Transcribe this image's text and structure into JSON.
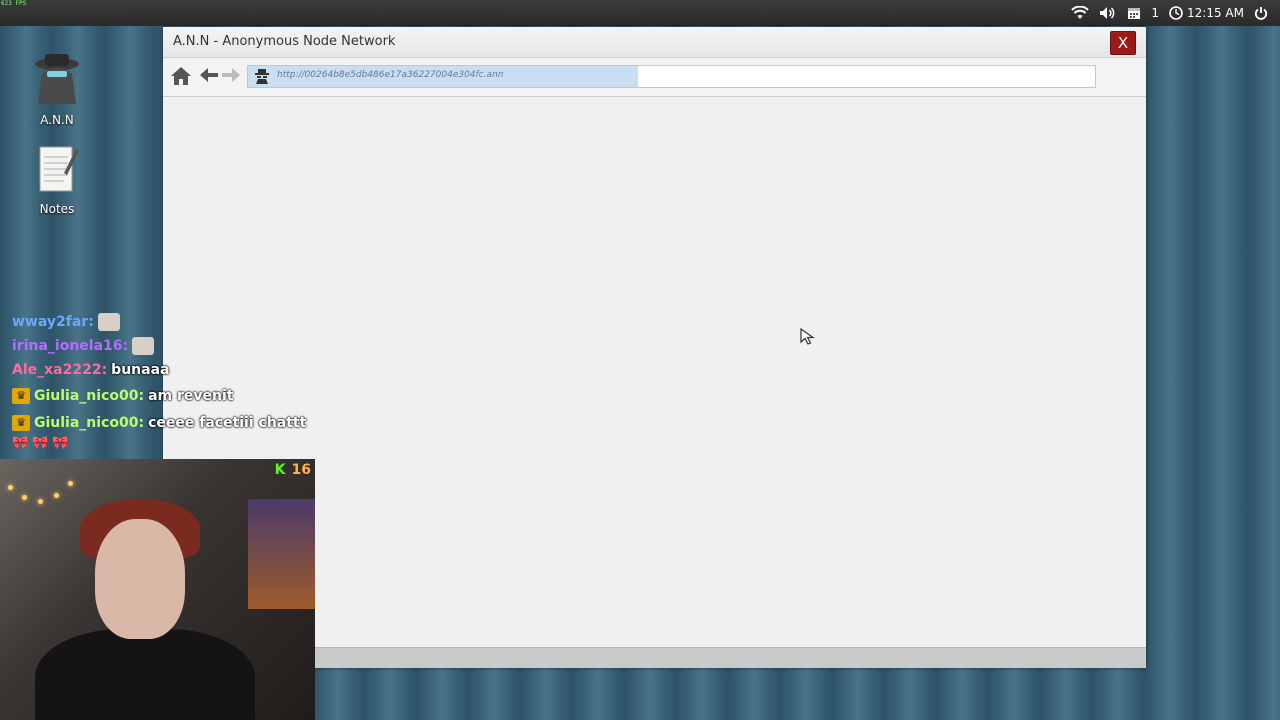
{
  "overlay": {
    "fps_text": "623 FPS"
  },
  "system_tray": {
    "notifications_count": "1",
    "time": "12:15 AM"
  },
  "desktop": {
    "icons": [
      {
        "label": "A.N.N",
        "icon": "hacker-hat-icon"
      },
      {
        "label": "Notes",
        "icon": "notepad-icon"
      }
    ]
  },
  "window": {
    "title": "A.N.N - Anonymous Node Network",
    "close_label": "X",
    "address_bar": {
      "url": "http://00264b8e5db486e17a36227004e304fc.ann",
      "load_progress": 0.46
    }
  },
  "chat": [
    {
      "user": "wway2far:",
      "user_color": "#6aa8ff",
      "badge": null,
      "message": "",
      "emote": true
    },
    {
      "user": "irina_ionela16:",
      "user_color": "#b46cff",
      "badge": null,
      "message": "",
      "emote": true
    },
    {
      "user": "Ale_xa2222:",
      "user_color": "#ff6aa0",
      "badge": null,
      "message": "bunaaa",
      "emote": false
    },
    {
      "user": "Giulia_nico00:",
      "user_color": "#b8ff6a",
      "badge": "crown-icon",
      "message": "am revenit",
      "emote": false
    },
    {
      "user": "Giulia_nico00:",
      "user_color": "#b8ff6a",
      "badge": "crown-icon",
      "message": "ceeee facetiii chattt",
      "emote": false
    }
  ],
  "chat_extra": {
    "bows": "🎀🎀🎀"
  },
  "webcam": {
    "badge_icon": "kick-logo-icon",
    "badge_count": "16"
  },
  "colors": {
    "close_button": "#9b1b1b",
    "url_progress": "#c9def2",
    "kick_green": "#53fc18"
  }
}
